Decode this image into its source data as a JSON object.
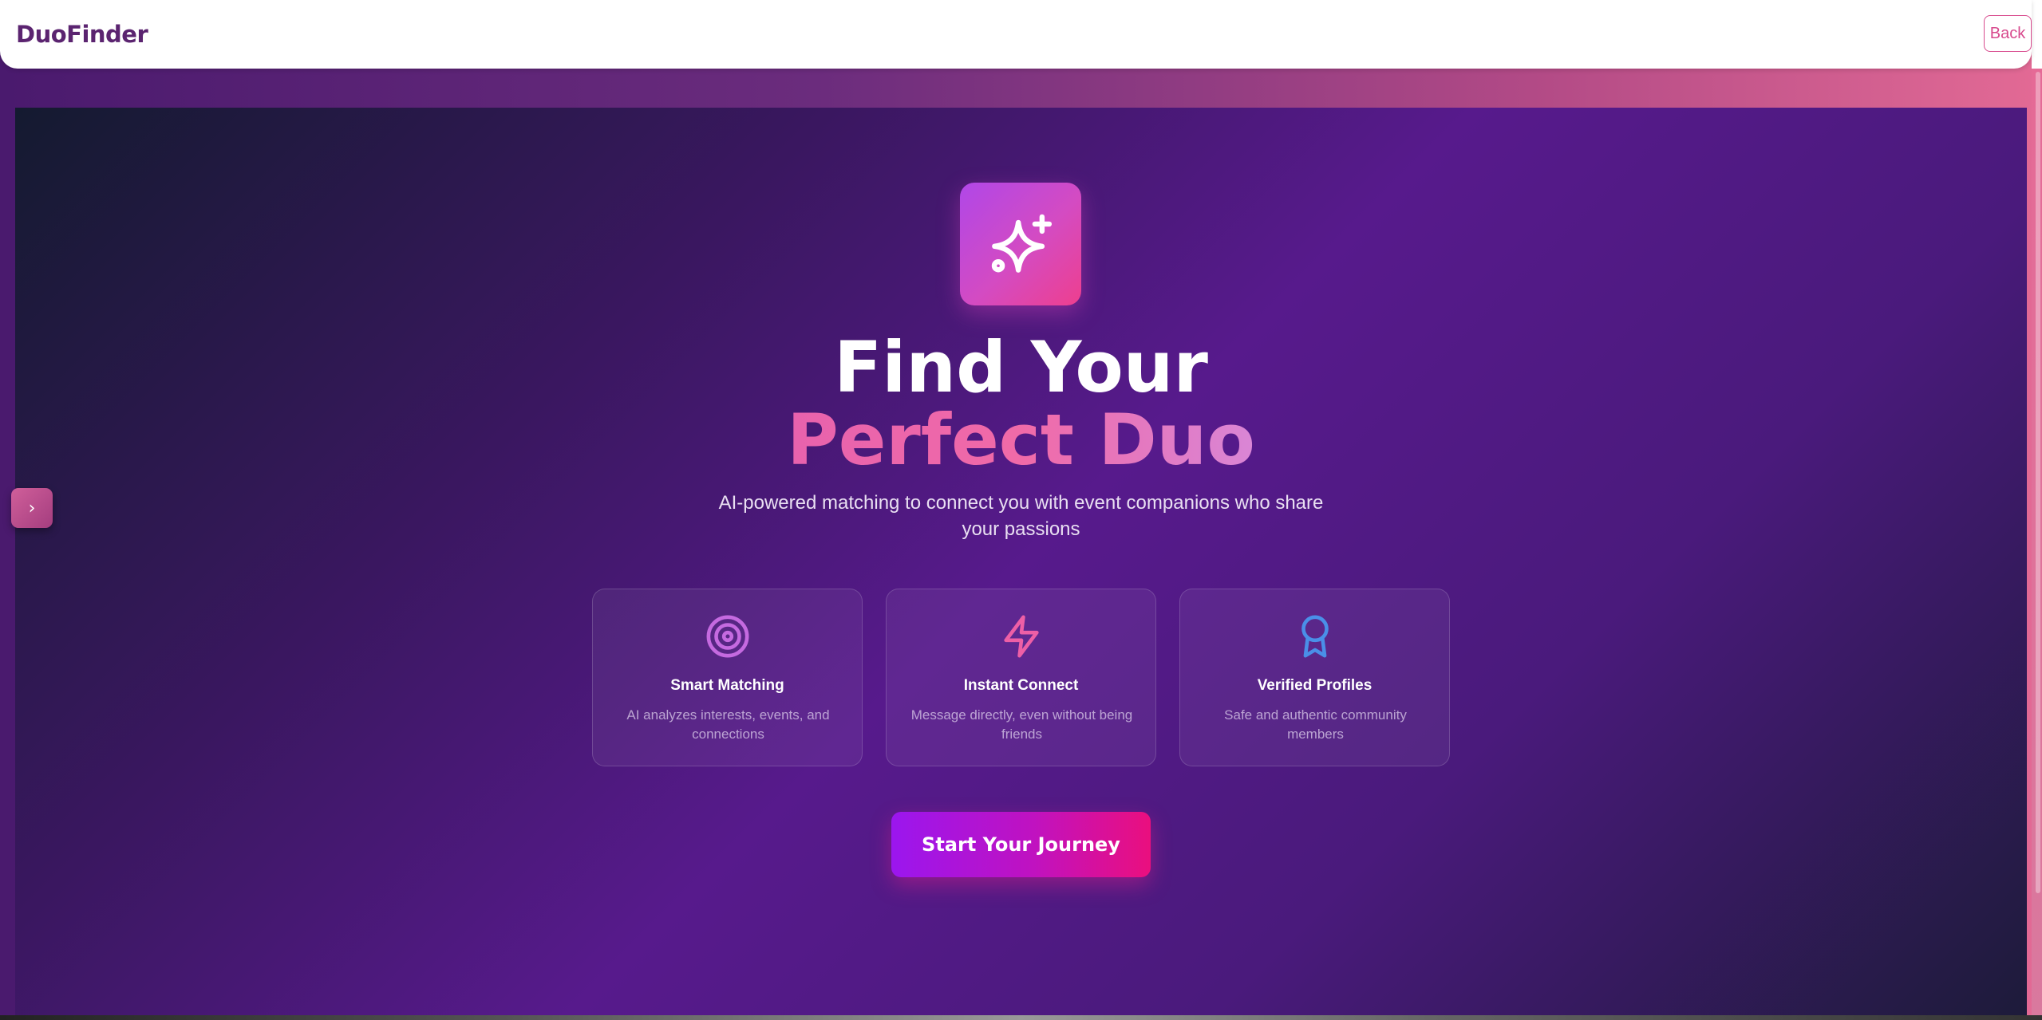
{
  "header": {
    "brand": "DuoFinder",
    "back_label": "Back"
  },
  "sidebar_toggle": {
    "glyph": "›",
    "icon": "chevron-right-icon"
  },
  "hero": {
    "logo_icon": "sparkles-icon",
    "headline_line1": "Find Your",
    "headline_line2": "Perfect Duo",
    "subtitle": "AI-powered matching to connect you with event companions who share your passions",
    "features": [
      {
        "icon": "target-icon",
        "icon_color": "#c56ae0",
        "title": "Smart Matching",
        "description": "AI analyzes interests, events, and connections"
      },
      {
        "icon": "zap-icon",
        "icon_color": "#ee5fa6",
        "title": "Instant Connect",
        "description": "Message directly, even without being friends"
      },
      {
        "icon": "award-icon",
        "icon_color": "#4a8fe8",
        "title": "Verified Profiles",
        "description": "Safe and authentic community members"
      }
    ],
    "cta_label": "Start Your Journey"
  },
  "colors": {
    "brand": "#5b2470",
    "accent_pink": "#d84b8e",
    "cta_start": "#9b16ee",
    "cta_end": "#ea0f7e"
  }
}
